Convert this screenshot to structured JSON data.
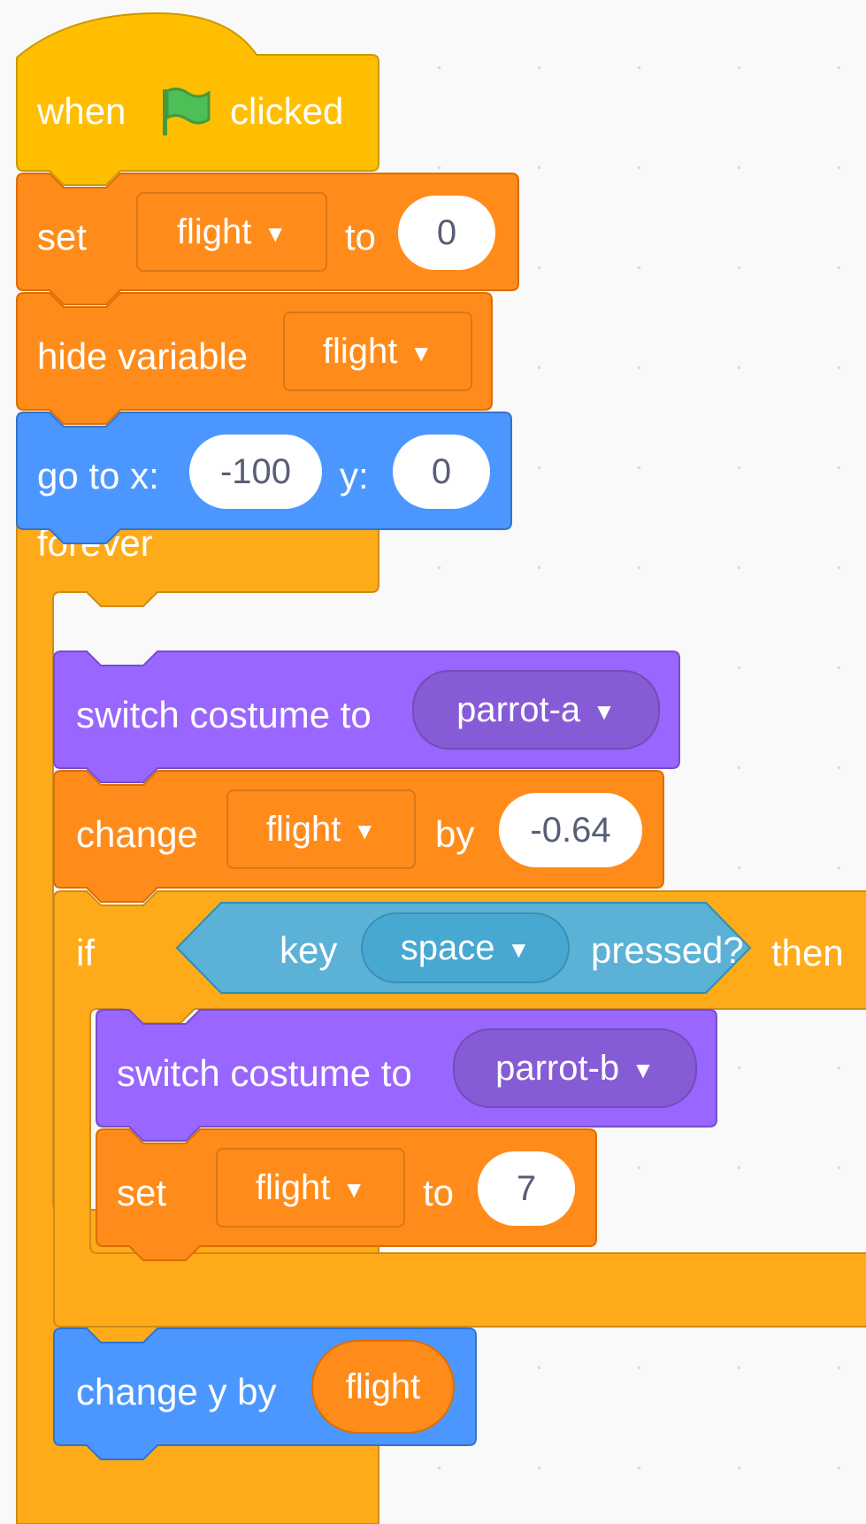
{
  "colors": {
    "events": "#FFBF00",
    "control": "#FFAB19",
    "variables": "#FF8C1A",
    "motion": "#4C97FF",
    "looks": "#9966FF",
    "sensing": "#5CB1D6",
    "reporter_var": "#FF8C1A",
    "number_text": "#575E75"
  },
  "script": {
    "hat": {
      "when": "when",
      "flag_icon": "green-flag-icon",
      "clicked": "clicked"
    },
    "set_flight": {
      "keyword": "set",
      "variable": "flight",
      "to": "to",
      "value": "0"
    },
    "hide_var": {
      "keyword": "hide variable",
      "variable": "flight"
    },
    "goto": {
      "keyword": "go to x:",
      "x": "-100",
      "y_label": "y:",
      "y": "0"
    },
    "forever": {
      "label": "forever",
      "loop_icon": "loop-arrow-icon"
    },
    "switch_a": {
      "keyword": "switch costume to",
      "costume": "parrot-a"
    },
    "change_flight": {
      "keyword": "change",
      "variable": "flight",
      "by": "by",
      "value": "-0.64"
    },
    "if_block": {
      "keyword": "if",
      "then": "then"
    },
    "key_pressed": {
      "key": "key",
      "option": "space",
      "pressed": "pressed?"
    },
    "switch_b": {
      "keyword": "switch costume to",
      "costume": "parrot-b"
    },
    "set_flight_7": {
      "keyword": "set",
      "variable": "flight",
      "to": "to",
      "value": "7"
    },
    "change_y": {
      "keyword": "change y by",
      "reporter": "flight"
    }
  }
}
